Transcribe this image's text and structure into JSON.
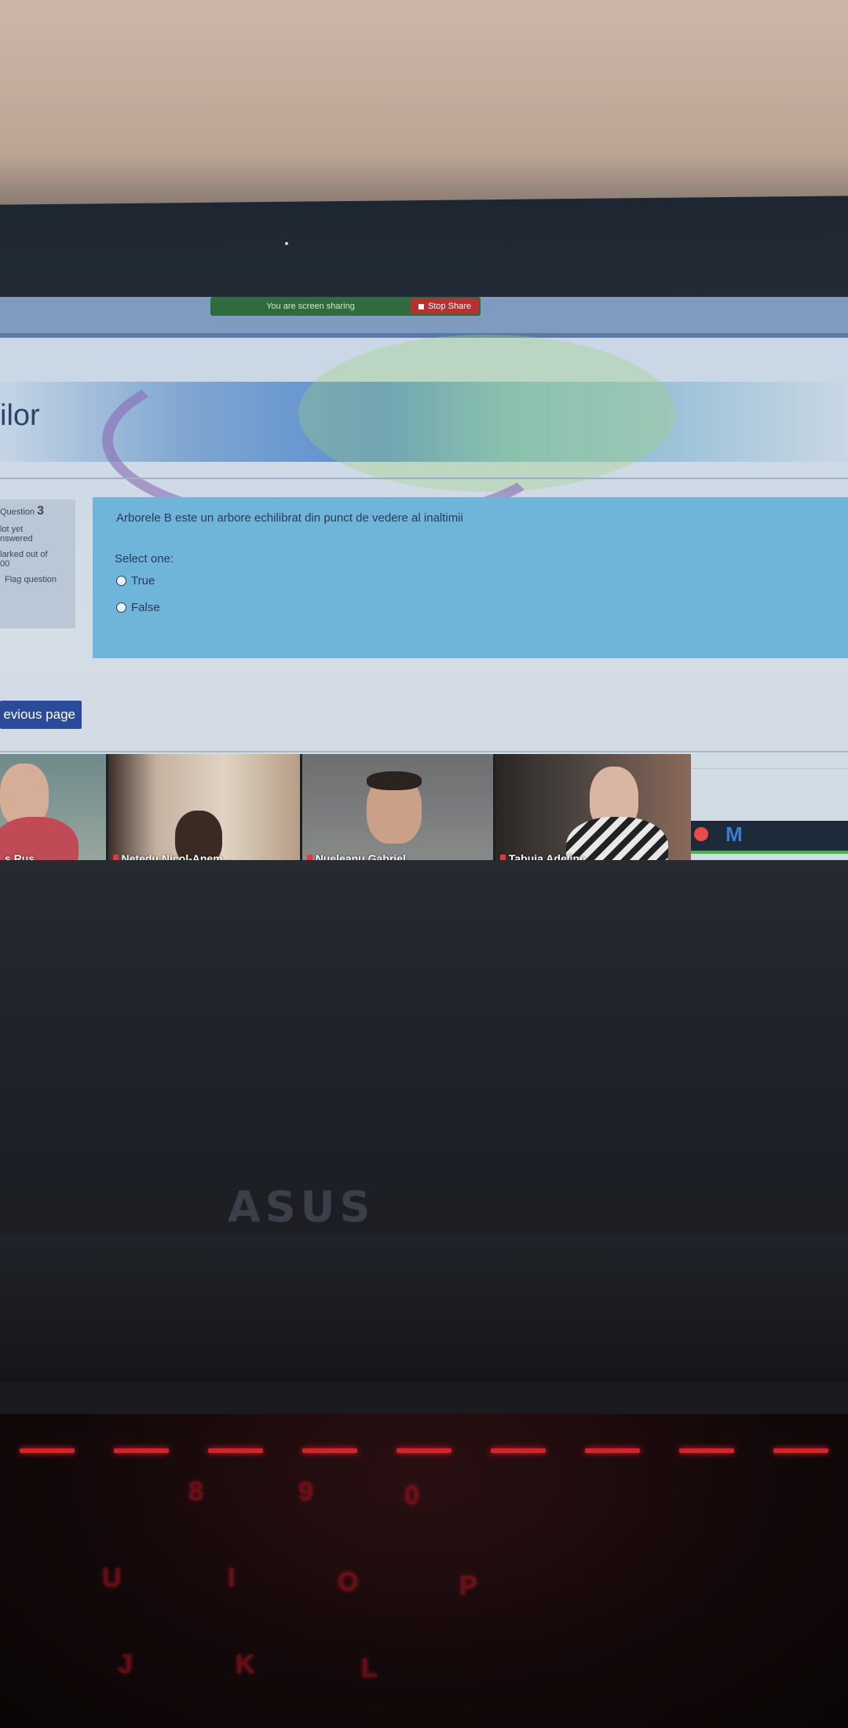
{
  "zoom_share": {
    "notice": "You are screen sharing",
    "stop_label": "Stop Share"
  },
  "page": {
    "course_title_fragment": "ilor"
  },
  "question_info": {
    "question_word": "Question",
    "question_number": "3",
    "status_line1": "lot yet",
    "status_line2": "nswered",
    "marked_line1": "larked out of",
    "marked_line2": "00",
    "flag_label": "Flag question"
  },
  "question": {
    "text": "Arborele B este un arbore echilibrat din punct de vedere al inaltimii",
    "select_prompt": "Select one:",
    "options": [
      {
        "label": "True",
        "selected": false
      },
      {
        "label": "False",
        "selected": false
      }
    ]
  },
  "navigation": {
    "previous_label": "evious page"
  },
  "participants": [
    {
      "name": "s Rus"
    },
    {
      "name": "Netedu Nicol-Anem..."
    },
    {
      "name": "Nueleanu Gabriel"
    },
    {
      "name": "Tabuia Adeline"
    }
  ],
  "laptop": {
    "brand_logo": "ASUS"
  },
  "colors": {
    "question_box": "#6fb4d9",
    "previous_button": "#2c4a9a",
    "stop_share": "#b63130",
    "keyboard_backlight": "#d2232a"
  }
}
